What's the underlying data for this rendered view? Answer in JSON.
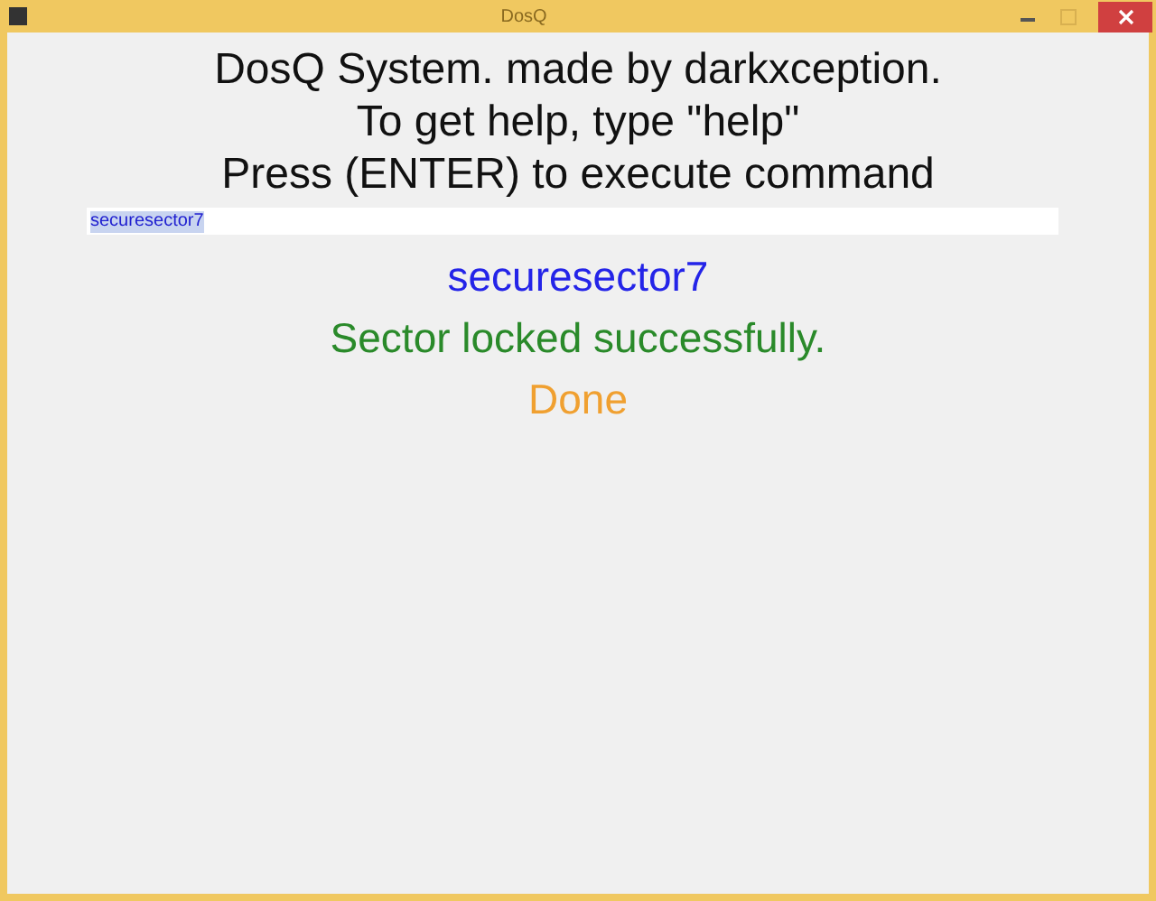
{
  "window": {
    "title": "DosQ"
  },
  "header_lines": [
    "DosQ System. made by darkxception.",
    "To get help, type \"help\"",
    "Press (ENTER) to execute command"
  ],
  "command_field": {
    "value": "securesector7",
    "selected": true
  },
  "output": [
    {
      "text": "securesector7",
      "kind": "echo"
    },
    {
      "text": "Sector locked successfully.",
      "kind": "success"
    },
    {
      "text": "Done",
      "kind": "status"
    }
  ]
}
